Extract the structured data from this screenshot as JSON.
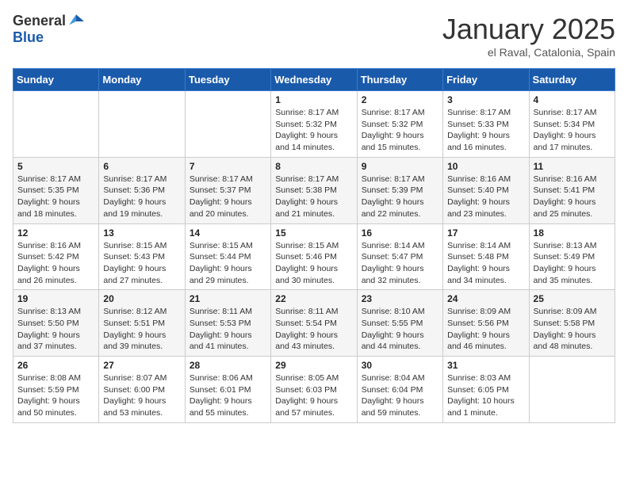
{
  "header": {
    "logo_general": "General",
    "logo_blue": "Blue",
    "title": "January 2025",
    "location": "el Raval, Catalonia, Spain"
  },
  "weekdays": [
    "Sunday",
    "Monday",
    "Tuesday",
    "Wednesday",
    "Thursday",
    "Friday",
    "Saturday"
  ],
  "weeks": [
    [
      {
        "day": "",
        "info": ""
      },
      {
        "day": "",
        "info": ""
      },
      {
        "day": "",
        "info": ""
      },
      {
        "day": "1",
        "info": "Sunrise: 8:17 AM\nSunset: 5:32 PM\nDaylight: 9 hours and 14 minutes."
      },
      {
        "day": "2",
        "info": "Sunrise: 8:17 AM\nSunset: 5:32 PM\nDaylight: 9 hours and 15 minutes."
      },
      {
        "day": "3",
        "info": "Sunrise: 8:17 AM\nSunset: 5:33 PM\nDaylight: 9 hours and 16 minutes."
      },
      {
        "day": "4",
        "info": "Sunrise: 8:17 AM\nSunset: 5:34 PM\nDaylight: 9 hours and 17 minutes."
      }
    ],
    [
      {
        "day": "5",
        "info": "Sunrise: 8:17 AM\nSunset: 5:35 PM\nDaylight: 9 hours and 18 minutes."
      },
      {
        "day": "6",
        "info": "Sunrise: 8:17 AM\nSunset: 5:36 PM\nDaylight: 9 hours and 19 minutes."
      },
      {
        "day": "7",
        "info": "Sunrise: 8:17 AM\nSunset: 5:37 PM\nDaylight: 9 hours and 20 minutes."
      },
      {
        "day": "8",
        "info": "Sunrise: 8:17 AM\nSunset: 5:38 PM\nDaylight: 9 hours and 21 minutes."
      },
      {
        "day": "9",
        "info": "Sunrise: 8:17 AM\nSunset: 5:39 PM\nDaylight: 9 hours and 22 minutes."
      },
      {
        "day": "10",
        "info": "Sunrise: 8:16 AM\nSunset: 5:40 PM\nDaylight: 9 hours and 23 minutes."
      },
      {
        "day": "11",
        "info": "Sunrise: 8:16 AM\nSunset: 5:41 PM\nDaylight: 9 hours and 25 minutes."
      }
    ],
    [
      {
        "day": "12",
        "info": "Sunrise: 8:16 AM\nSunset: 5:42 PM\nDaylight: 9 hours and 26 minutes."
      },
      {
        "day": "13",
        "info": "Sunrise: 8:15 AM\nSunset: 5:43 PM\nDaylight: 9 hours and 27 minutes."
      },
      {
        "day": "14",
        "info": "Sunrise: 8:15 AM\nSunset: 5:44 PM\nDaylight: 9 hours and 29 minutes."
      },
      {
        "day": "15",
        "info": "Sunrise: 8:15 AM\nSunset: 5:46 PM\nDaylight: 9 hours and 30 minutes."
      },
      {
        "day": "16",
        "info": "Sunrise: 8:14 AM\nSunset: 5:47 PM\nDaylight: 9 hours and 32 minutes."
      },
      {
        "day": "17",
        "info": "Sunrise: 8:14 AM\nSunset: 5:48 PM\nDaylight: 9 hours and 34 minutes."
      },
      {
        "day": "18",
        "info": "Sunrise: 8:13 AM\nSunset: 5:49 PM\nDaylight: 9 hours and 35 minutes."
      }
    ],
    [
      {
        "day": "19",
        "info": "Sunrise: 8:13 AM\nSunset: 5:50 PM\nDaylight: 9 hours and 37 minutes."
      },
      {
        "day": "20",
        "info": "Sunrise: 8:12 AM\nSunset: 5:51 PM\nDaylight: 9 hours and 39 minutes."
      },
      {
        "day": "21",
        "info": "Sunrise: 8:11 AM\nSunset: 5:53 PM\nDaylight: 9 hours and 41 minutes."
      },
      {
        "day": "22",
        "info": "Sunrise: 8:11 AM\nSunset: 5:54 PM\nDaylight: 9 hours and 43 minutes."
      },
      {
        "day": "23",
        "info": "Sunrise: 8:10 AM\nSunset: 5:55 PM\nDaylight: 9 hours and 44 minutes."
      },
      {
        "day": "24",
        "info": "Sunrise: 8:09 AM\nSunset: 5:56 PM\nDaylight: 9 hours and 46 minutes."
      },
      {
        "day": "25",
        "info": "Sunrise: 8:09 AM\nSunset: 5:58 PM\nDaylight: 9 hours and 48 minutes."
      }
    ],
    [
      {
        "day": "26",
        "info": "Sunrise: 8:08 AM\nSunset: 5:59 PM\nDaylight: 9 hours and 50 minutes."
      },
      {
        "day": "27",
        "info": "Sunrise: 8:07 AM\nSunset: 6:00 PM\nDaylight: 9 hours and 53 minutes."
      },
      {
        "day": "28",
        "info": "Sunrise: 8:06 AM\nSunset: 6:01 PM\nDaylight: 9 hours and 55 minutes."
      },
      {
        "day": "29",
        "info": "Sunrise: 8:05 AM\nSunset: 6:03 PM\nDaylight: 9 hours and 57 minutes."
      },
      {
        "day": "30",
        "info": "Sunrise: 8:04 AM\nSunset: 6:04 PM\nDaylight: 9 hours and 59 minutes."
      },
      {
        "day": "31",
        "info": "Sunrise: 8:03 AM\nSunset: 6:05 PM\nDaylight: 10 hours and 1 minute."
      },
      {
        "day": "",
        "info": ""
      }
    ]
  ]
}
